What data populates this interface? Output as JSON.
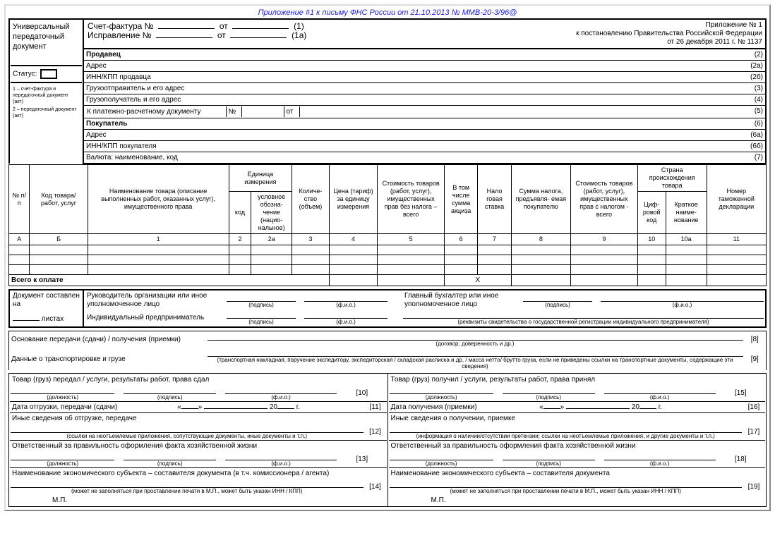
{
  "topNote": "Приложение #1 к письму ФНС России от 21.10.2013 № ММВ-20-3/96@",
  "docTitle1": "Универсальный",
  "docTitle2": "передаточный",
  "docTitle3": "документ",
  "statusLabel": "Статус:",
  "statusNote1": "1 – счет-фактура и передаточный документ (акт)",
  "statusNote2": "2 – передаточный документ (акт)",
  "invoice": {
    "line1a": "Счет-фактура №",
    "line1b": "от",
    "line1c": "(1)",
    "line2a": "Исправление №",
    "line2b": "от",
    "line2c": "(1а)"
  },
  "appx": {
    "l1": "Приложение № 1",
    "l2": "к постановлению Правительства Российской Федерации",
    "l3": "от 26 декабря 2011 г. № 1137"
  },
  "seller": {
    "title": "Продавец",
    "tag": "(2)",
    "addr": "Адрес",
    "addrTag": "(2а)",
    "inn": "ИНН/КПП продавца",
    "innTag": "(2б)",
    "ship": "Грузоотправитель и его адрес",
    "shipTag": "(3)",
    "recv": "Грузополучатель и его адрес",
    "recvTag": "(4)",
    "pay": "К платежно-расчетному документу",
    "payNo": "№",
    "payOt": "от",
    "payTag": "(5)"
  },
  "buyer": {
    "title": "Покупатель",
    "tag": "(6)",
    "addr": "Адрес",
    "addrTag": "(6а)",
    "inn": "ИНН/КПП покупателя",
    "innTag": "(6б)",
    "cur": "Валюта: наименование, код",
    "curTag": "(7)"
  },
  "cols": {
    "np": "№ п/п",
    "code": "Код товара/ работ, услуг",
    "name": "Наименование товара (описание выполненных работ, оказанных услуг), имущественного права",
    "unit": "Единица измерения",
    "ucode": "код",
    "uname": "условное обозна- чение (нацио- нальное)",
    "qty": "Количе- ство (объем)",
    "price": "Цена (тариф) за единицу измерения",
    "cost": "Стоимость товаров (работ, услуг), имущественных прав без налога – всего",
    "excise": "В том числе сумма акциза",
    "rate": "Нало говая ставка",
    "tax": "Сумма налога, предъявля- емая покупателю",
    "total": "Стоимость товаров (работ, услуг), имущественных прав с налогом - всего",
    "country": "Страна происхождения товара",
    "ccode": "Циф- ровой код",
    "cname": "Краткое наиме- нование",
    "decl": "Номер таможенной декларации"
  },
  "colnums": {
    "a": "А",
    "b": "Б",
    "1": "1",
    "2": "2",
    "2a": "2а",
    "3": "3",
    "4": "4",
    "5": "5",
    "6": "6",
    "7": "7",
    "8": "8",
    "9": "9",
    "10": "10",
    "10a": "10а",
    "11": "11"
  },
  "totalPay": "Всего к оплате",
  "totalX": "Х",
  "docComposed": "Документ составлен на",
  "sheets": "листах",
  "sig": {
    "head": "Руководитель организации или иное уполномоченное лицо",
    "acc": "Главный бухгалтер или иное уполномоченное лицо",
    "ip": "Индивидуальный предприниматель",
    "pod": "(подпись)",
    "fio": "(ф.и.о.)",
    "rekv": "(реквизиты свидетельства о государственной регистрации индивидуального предпринимателя)"
  },
  "lower": {
    "basis": "Основание передачи (сдачи) / получения (приемки)",
    "basisHint": "(договор; доверенность и др.)",
    "basisTag": "[8]",
    "trans": "Данные о транспортировке и грузе",
    "transHint": "(транспортная накладная, поручение экспедитору, экспедиторская / складская расписка и др. / масса нетто/ брутто груза, если не приведены ссылки на транспортные документы, содержащие эти сведения)",
    "transTag": "[9]"
  },
  "left": {
    "handed": "Товар (груз) передал / услуги, результаты работ, права сдал",
    "handedTag": "[10]",
    "pos": "(должность)",
    "pod": "(подпись)",
    "fio": "(ф.и.о.)",
    "date": "Дата отгрузки, передачи (сдачи)",
    "dateQ": "«",
    "dateQ2": "»",
    "dateY": "20",
    "dateG": "г.",
    "dateTag": "[11]",
    "other": "Иные сведения об отгрузке, передаче",
    "otherTag": "[12]",
    "otherHint": "(ссылки на неотъемлемые приложения, сопутствующие документы, иные документы и т.п.)",
    "resp": "Ответственный за правильность оформления факта хозяйственной жизни",
    "respTag": "[13]",
    "econ": "Наименование экономического субъекта – составителя документа (в т.ч. комиссионера / агента)",
    "econTag": "[14]",
    "econHint": "(может не заполняться при проставлении печати в М.П., может быть указан ИНН / КПП)",
    "mp": "М.П."
  },
  "right": {
    "recv": "Товар (груз) получил / услуги, результаты работ, права принял",
    "recvTag": "[15]",
    "date": "Дата получения (приемки)",
    "dateTag": "[16]",
    "other": "Иные сведения о получении, приемке",
    "otherTag": "[17]",
    "otherHint": "(информация о наличии/отсутствии претензии; ссылки на неотъемлемые приложения, и другие документы и т.п.)",
    "resp": "Ответственный за правильность оформления факта хозяйственной жизни",
    "respTag": "[18]",
    "econ": "Наименование экономического субъекта – составителя документа",
    "econTag": "[19]",
    "econHint": "(может не заполняться при проставлении печати в М.П., может быть указан ИНН / КПП)",
    "mp": "М.П."
  }
}
